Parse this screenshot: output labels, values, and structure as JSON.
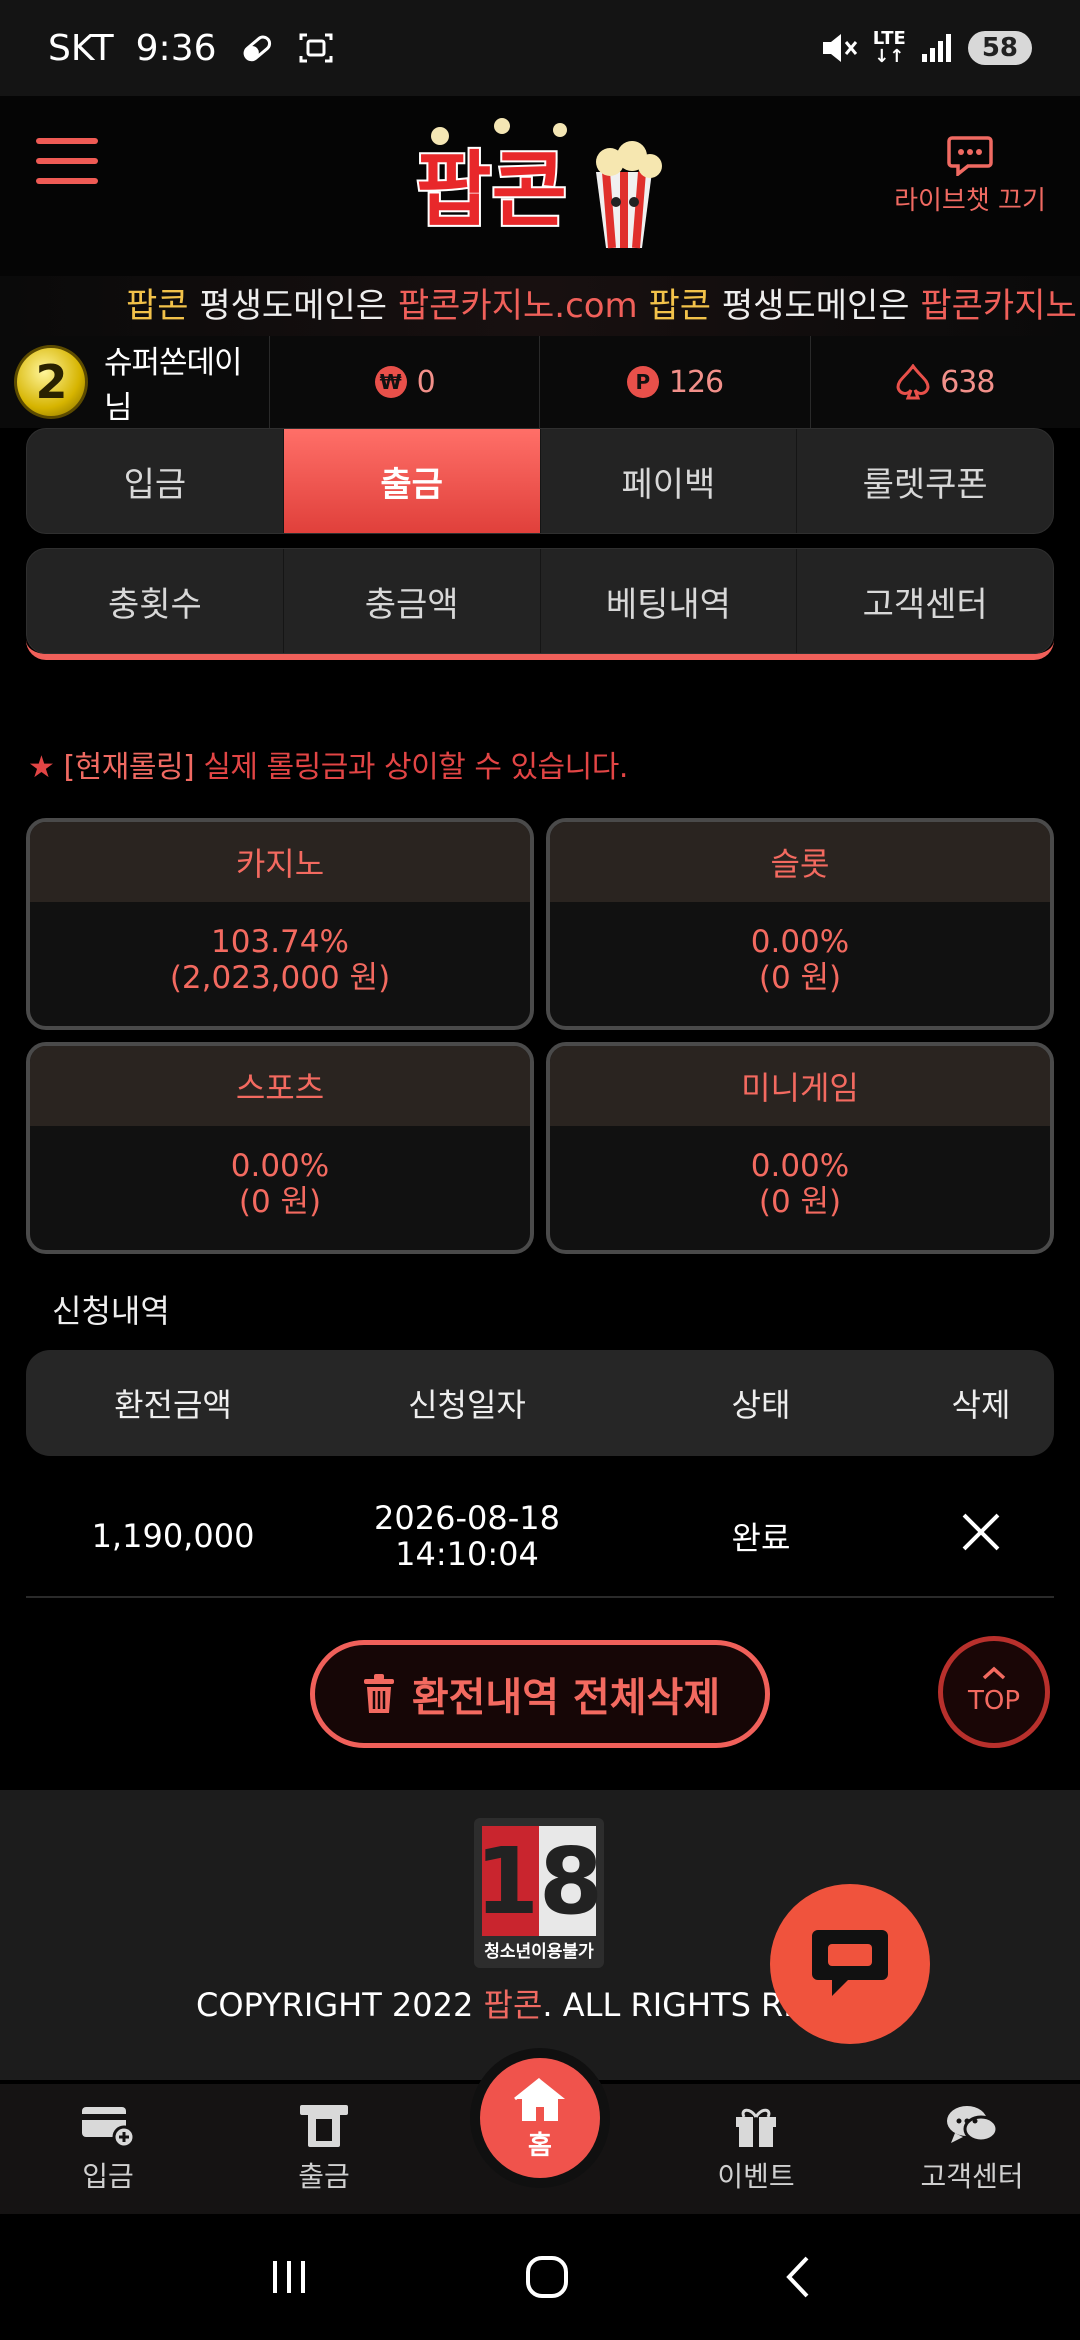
{
  "status_bar": {
    "carrier": "SKT",
    "time": "9:36",
    "network": "LTE",
    "battery": "58"
  },
  "header": {
    "logo_text": "팝콘",
    "live_chat_label": "라이브챗 끄기"
  },
  "ticker": {
    "segments": [
      {
        "text": "팝콘",
        "color": "#f2c24a"
      },
      {
        "text": " 평생도메인은 ",
        "color": "#eeeeee"
      },
      {
        "text": "팝콘카지노.com",
        "color": "#f0605a"
      },
      {
        "text": " 팝콘",
        "color": "#f2c24a"
      },
      {
        "text": " 평생도메인은 ",
        "color": "#eeeeee"
      },
      {
        "text": "팝콘카지노.com",
        "color": "#f0605a"
      }
    ]
  },
  "user": {
    "level": "2",
    "nickname": "슈퍼쏜데이님",
    "won": "0",
    "points": "126",
    "spades": "638"
  },
  "tabs_primary": [
    {
      "label": "입금",
      "active": false
    },
    {
      "label": "출금",
      "active": true
    },
    {
      "label": "페이백",
      "active": false
    },
    {
      "label": "룰렛쿠폰",
      "active": false
    }
  ],
  "tabs_secondary": [
    {
      "label": "충횟수"
    },
    {
      "label": "충금액"
    },
    {
      "label": "베팅내역"
    },
    {
      "label": "고객센터"
    }
  ],
  "notice": {
    "star": "★",
    "bracket": "[현재롤링]",
    "text": "실제 롤링금과 상이할 수 있습니다."
  },
  "rolling": [
    {
      "title": "카지노",
      "percent": "103.74%",
      "amount": "(2,023,000 원)"
    },
    {
      "title": "슬롯",
      "percent": "0.00%",
      "amount": "(0 원)"
    },
    {
      "title": "스포츠",
      "percent": "0.00%",
      "amount": "(0 원)"
    },
    {
      "title": "미니게임",
      "percent": "0.00%",
      "amount": "(0 원)"
    }
  ],
  "history": {
    "title": "신청내역",
    "columns": [
      "환전금액",
      "신청일자",
      "상태",
      "삭제"
    ],
    "rows": [
      {
        "amount": "1,190,000",
        "date": "2026-08-18",
        "time": "14:10:04",
        "status": "완료"
      }
    ]
  },
  "delete_all_label": "환전내역 전체삭제",
  "top_label": "TOP",
  "footer": {
    "age_badge": "18",
    "age_label": "청소년이용불가",
    "copyright_prefix": "COPYRIGHT 2022 ",
    "copyright_brand": "팝콘",
    "copyright_suffix": ". ALL RIGHTS RESE"
  },
  "bottom_nav": {
    "deposit": "입금",
    "withdraw": "출금",
    "home": "홈",
    "event": "이벤트",
    "support": "고객센터"
  },
  "colors": {
    "accent": "#f0605a",
    "gold": "#f2c24a",
    "card_bg": "#111111",
    "card_header": "#2a2420"
  }
}
